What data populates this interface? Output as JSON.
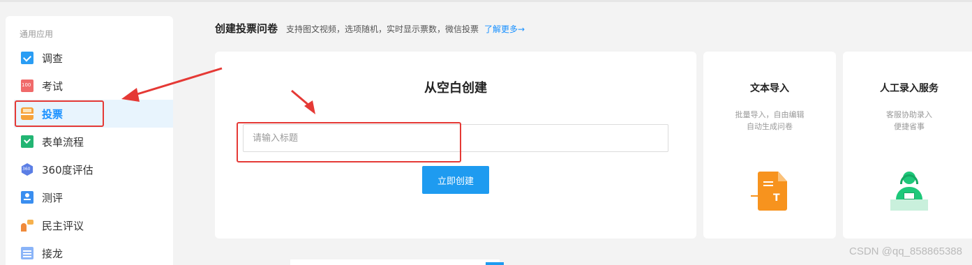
{
  "sidebar": {
    "heading": "通用应用",
    "items": [
      {
        "label": "调查",
        "icon": "survey-icon"
      },
      {
        "label": "考试",
        "icon": "exam-icon"
      },
      {
        "label": "投票",
        "icon": "vote-icon",
        "active": true
      },
      {
        "label": "表单流程",
        "icon": "form-flow-icon"
      },
      {
        "label": "360度评估",
        "icon": "360-evaluation-icon"
      },
      {
        "label": "测评",
        "icon": "assessment-icon"
      },
      {
        "label": "民主评议",
        "icon": "democratic-review-icon"
      },
      {
        "label": "接龙",
        "icon": "relay-icon"
      }
    ]
  },
  "header": {
    "title": "创建投票问卷",
    "description": "支持图文视频，选项随机，实时显示票数，微信投票",
    "learn_more": "了解更多→"
  },
  "create_blank": {
    "title": "从空白创建",
    "input_placeholder": "请输入标题",
    "input_value": "",
    "button_label": "立即创建"
  },
  "text_import": {
    "title": "文本导入",
    "desc_line1": "批量导入，自由编辑",
    "desc_line2": "自动生成问卷",
    "icon": "document-import-icon"
  },
  "manual_entry": {
    "title": "人工录入服务",
    "desc_line1": "客服协助录入",
    "desc_line2": "便捷省事",
    "icon": "customer-service-icon"
  },
  "watermark": "CSDN @qq_858865388",
  "colors": {
    "accent": "#1e9bf0",
    "annotation_red": "#e53935",
    "active_bg": "#e8f4fd"
  }
}
